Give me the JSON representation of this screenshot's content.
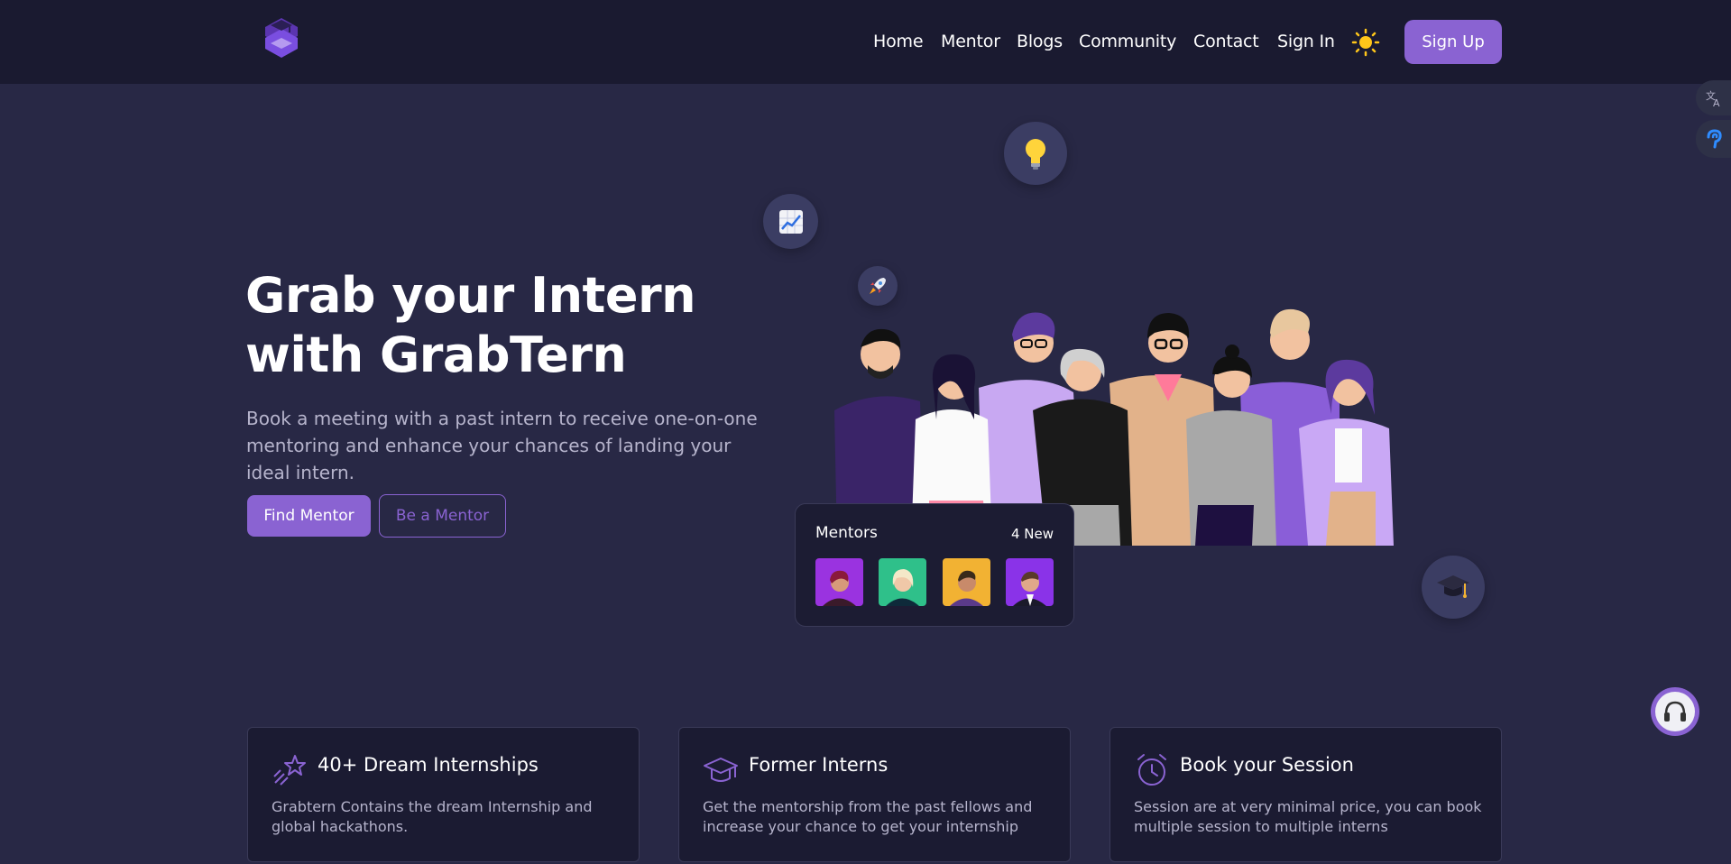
{
  "nav": {
    "links": [
      "Home",
      "Mentor",
      "Blogs",
      "Community",
      "Contact",
      "Sign In"
    ],
    "signup_label": "Sign Up",
    "theme_icon": "sun-icon"
  },
  "hero": {
    "title": "Grab your Intern with GrabTern",
    "subtitle": "Book a meeting with a past intern to receive one-on-one mentoring and enhance your chances of landing your ideal intern.",
    "primary_btn": "Find Mentor",
    "secondary_btn": "Be a Mentor"
  },
  "mentors_card": {
    "title": "Mentors",
    "badge": "4 New"
  },
  "features": [
    {
      "title": "40+ Dream Internships",
      "desc": "Grabtern Contains the dream Internship and global hackathons.",
      "icon": "star-icon"
    },
    {
      "title": "Former Interns",
      "desc": "Get the mentorship from the past fellows and increase your chance to get your internship",
      "icon": "graduation-cap-icon"
    },
    {
      "title": "Book your Session",
      "desc": "Session are at very minimal price, you can book multiple session to multiple interns",
      "icon": "alarm-clock-icon"
    }
  ],
  "colors": {
    "background": "#282845",
    "navbar": "#1a1a30",
    "accent": "#8a63d2",
    "muted_text": "#b6b4cc"
  }
}
